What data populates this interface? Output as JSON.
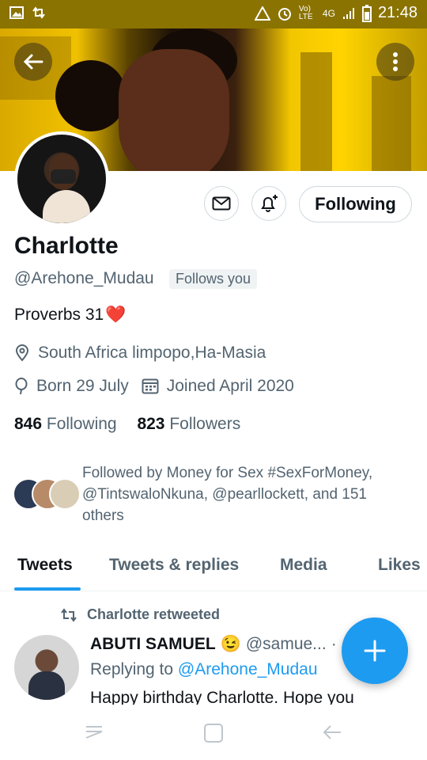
{
  "status_bar": {
    "time": "21:48",
    "network": "4G",
    "volte": "Vo) LTE"
  },
  "profile": {
    "name": "Charlotte",
    "handle": "@Arehone_Mudau",
    "follows_you": "Follows you",
    "bio": "Proverbs 31",
    "bio_emoji": "❤️",
    "location": "South Africa limpopo,Ha-Masia",
    "born": "Born 29 July",
    "joined": "Joined April 2020",
    "following_count": "846",
    "following_label": "Following",
    "followers_count": "823",
    "followers_label": "Followers",
    "followed_by": "Followed by Money for Sex #SexForMoney, @TintswaloNkuna, @pearllockett, and 151 others"
  },
  "actions": {
    "follow_label": "Following"
  },
  "tabs": [
    {
      "label": "Tweets"
    },
    {
      "label": "Tweets & replies"
    },
    {
      "label": "Media"
    },
    {
      "label": "Likes"
    }
  ],
  "tweet": {
    "retweet_label": "Charlotte retweeted",
    "author": "ABUTI SAMUEL",
    "emoji": "😉",
    "handle": "@samue...",
    "dot": "·",
    "replying_prefix": "Replying to",
    "replying_to": "@Arehone_Mudau",
    "text": "Happy birthday Charlotte. Hope you"
  },
  "colors": {
    "accent": "#1d9bf0",
    "status_bar": "#8a7300",
    "muted": "#536471"
  },
  "icons": [
    "back-arrow-icon",
    "more-icon",
    "mail-icon",
    "bell-plus-icon",
    "location-icon",
    "balloon-icon",
    "calendar-icon",
    "retweet-icon",
    "compose-plus-icon",
    "recents-icon",
    "home-icon",
    "back-icon"
  ]
}
